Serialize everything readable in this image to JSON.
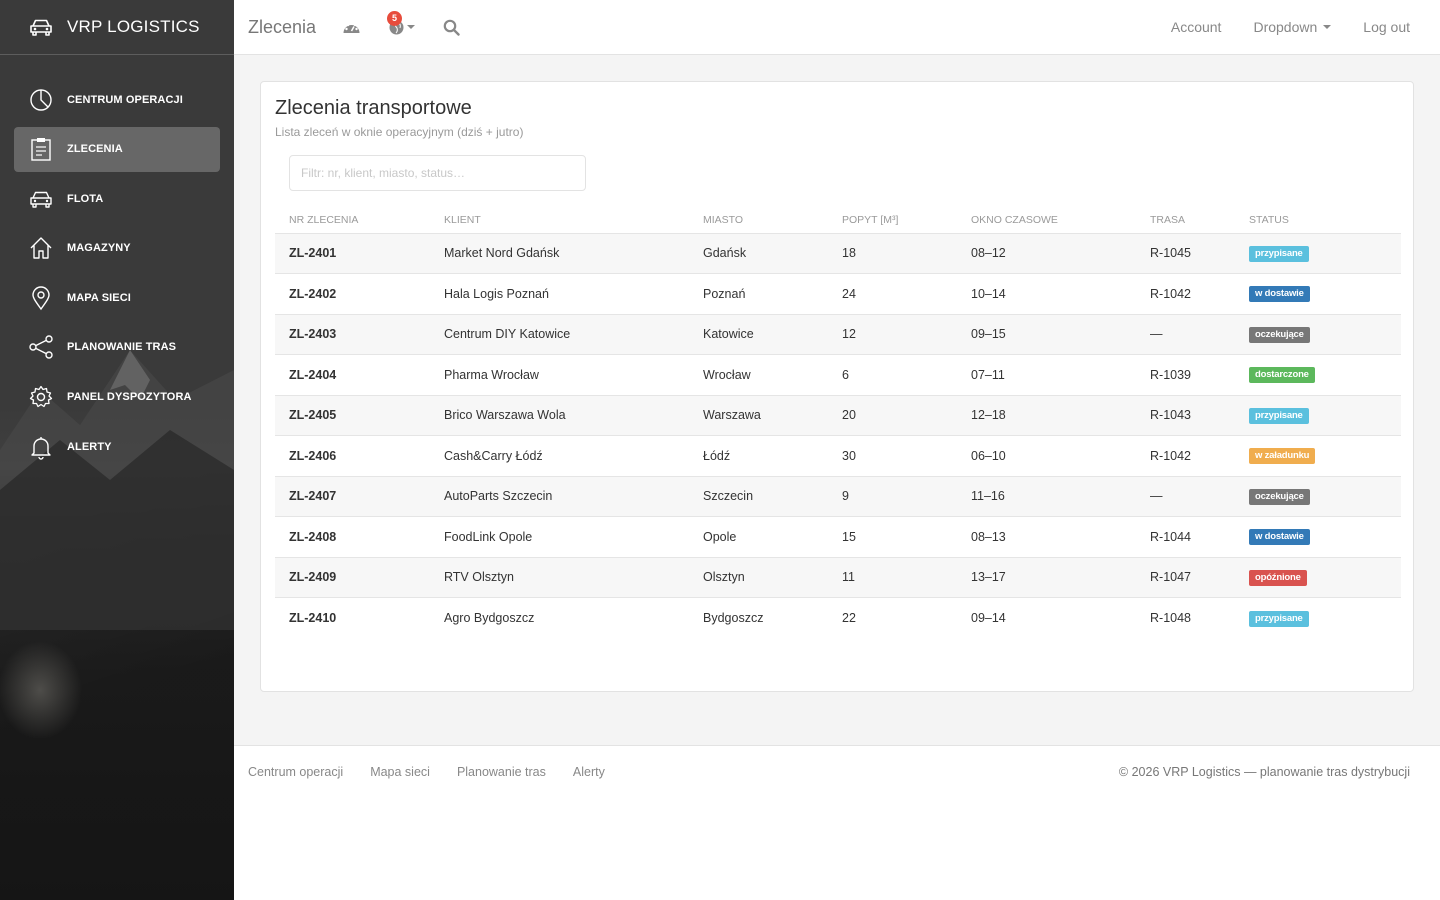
{
  "brand": {
    "name": "VRP LOGISTICS",
    "icon": "car-icon"
  },
  "sidebar": {
    "items": [
      {
        "label": "CENTRUM OPERACJI",
        "icon": "pie-chart-icon",
        "active": false
      },
      {
        "label": "ZLECENIA",
        "icon": "clipboard-icon",
        "active": true
      },
      {
        "label": "FLOTA",
        "icon": "car-icon",
        "active": false
      },
      {
        "label": "MAGAZYNY",
        "icon": "home-icon",
        "active": false
      },
      {
        "label": "MAPA SIECI",
        "icon": "map-pin-icon",
        "active": false
      },
      {
        "label": "PLANOWANIE TRAS",
        "icon": "share-icon",
        "active": false
      },
      {
        "label": "PANEL DYSPOZYTORA",
        "icon": "gear-icon",
        "active": false
      },
      {
        "label": "ALERTY",
        "icon": "bell-icon",
        "active": false
      }
    ]
  },
  "header": {
    "title": "Zlecenia",
    "notifications_count": "5",
    "menu": {
      "account": "Account",
      "dropdown": "Dropdown",
      "logout": "Log out"
    }
  },
  "card": {
    "title": "Zlecenia transportowe",
    "subtitle": "Lista zleceń w oknie operacyjnym (dziś + jutro)",
    "filter_placeholder": "Filtr: nr, klient, miasto, status…"
  },
  "table": {
    "columns": [
      "NR ZLECENIA",
      "KLIENT",
      "MIASTO",
      "POPYT [M³]",
      "OKNO CZASOWE",
      "TRASA",
      "STATUS"
    ],
    "rows": [
      {
        "id": "ZL-2401",
        "client": "Market Nord Gdańsk",
        "city": "Gdańsk",
        "demand": "18",
        "window": "08–12",
        "route": "R-1045",
        "status": "przypisane",
        "status_color": "#5bc0de"
      },
      {
        "id": "ZL-2402",
        "client": "Hala Logis Poznań",
        "city": "Poznań",
        "demand": "24",
        "window": "10–14",
        "route": "R-1042",
        "status": "w dostawie",
        "status_color": "#337ab7"
      },
      {
        "id": "ZL-2403",
        "client": "Centrum DIY Katowice",
        "city": "Katowice",
        "demand": "12",
        "window": "09–15",
        "route": "—",
        "status": "oczekujące",
        "status_color": "#777777"
      },
      {
        "id": "ZL-2404",
        "client": "Pharma Wrocław",
        "city": "Wrocław",
        "demand": "6",
        "window": "07–11",
        "route": "R-1039",
        "status": "dostarczone",
        "status_color": "#5cb85c"
      },
      {
        "id": "ZL-2405",
        "client": "Brico Warszawa Wola",
        "city": "Warszawa",
        "demand": "20",
        "window": "12–18",
        "route": "R-1043",
        "status": "przypisane",
        "status_color": "#5bc0de"
      },
      {
        "id": "ZL-2406",
        "client": "Cash&Carry Łódź",
        "city": "Łódź",
        "demand": "30",
        "window": "06–10",
        "route": "R-1042",
        "status": "w załadunku",
        "status_color": "#f0ad4e"
      },
      {
        "id": "ZL-2407",
        "client": "AutoParts Szczecin",
        "city": "Szczecin",
        "demand": "9",
        "window": "11–16",
        "route": "—",
        "status": "oczekujące",
        "status_color": "#777777"
      },
      {
        "id": "ZL-2408",
        "client": "FoodLink Opole",
        "city": "Opole",
        "demand": "15",
        "window": "08–13",
        "route": "R-1044",
        "status": "w dostawie",
        "status_color": "#337ab7"
      },
      {
        "id": "ZL-2409",
        "client": "RTV Olsztyn",
        "city": "Olsztyn",
        "demand": "11",
        "window": "13–17",
        "route": "R-1047",
        "status": "opóźnione",
        "status_color": "#d9534f"
      },
      {
        "id": "ZL-2410",
        "client": "Agro Bydgoszcz",
        "city": "Bydgoszcz",
        "demand": "22",
        "window": "09–14",
        "route": "R-1048",
        "status": "przypisane",
        "status_color": "#5bc0de"
      }
    ]
  },
  "footer": {
    "links": [
      "Centrum operacji",
      "Mapa sieci",
      "Planowanie tras",
      "Alerty"
    ],
    "copyright": "© 2026 VRP Logistics — planowanie tras dystrybucji"
  }
}
